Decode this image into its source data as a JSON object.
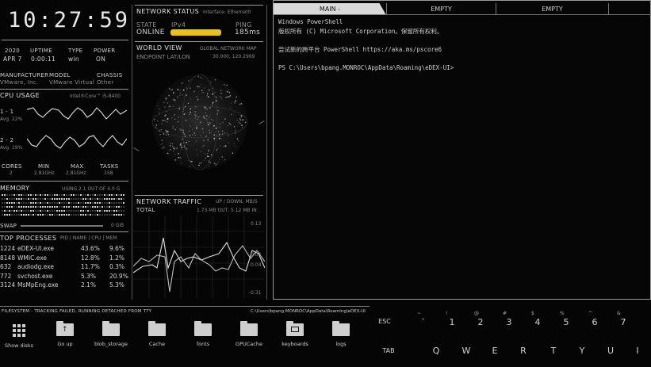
{
  "clock": {
    "time": "10:27:59"
  },
  "sysinfo": {
    "headers": [
      "2020",
      "UPTIME",
      "TYPE",
      "POWER"
    ],
    "values": [
      "APR 7",
      "0:00:11",
      "win",
      "ON"
    ],
    "hw_headers": [
      "MANUFACTURER",
      "MODEL",
      "CHASSIS"
    ],
    "hw_values": [
      "VMware, Inc.",
      "VMware Virtual",
      "Other"
    ]
  },
  "cpu": {
    "title": "CPU USAGE",
    "model": "Intel®Core™ i5-8400",
    "core1_label": "1 - 1",
    "core1_avg": "Avg. 22%",
    "core2_label": "2 - 2",
    "core2_avg": "Avg. 19%",
    "stat_headers": [
      "CORES",
      "MIN",
      "MAX",
      "TASKS"
    ],
    "stat_values": [
      "2",
      "2.81GHz",
      "2.81GHz",
      "158"
    ]
  },
  "memory": {
    "title": "MEMORY",
    "usage": "USING 2.1 OUT OF 4.0 G",
    "swap_label": "SWAP",
    "swap_value": "0 GiB"
  },
  "processes": {
    "title": "TOP PROCESSES",
    "header": "PID | NAME | CPU | MEM",
    "rows": [
      {
        "pid": "1224",
        "name": "eDEX-UI.exe",
        "cpu": "43.6%",
        "mem": "9.6%"
      },
      {
        "pid": "8148",
        "name": "WMIC.exe",
        "cpu": "12.8%",
        "mem": "1.2%"
      },
      {
        "pid": "632",
        "name": "audiodg.exe",
        "cpu": "11.7%",
        "mem": "0.3%"
      },
      {
        "pid": "772",
        "name": "svchost.exe",
        "cpu": "5.3%",
        "mem": "20.9%"
      },
      {
        "pid": "3124",
        "name": "MsMpEng.exe",
        "cpu": "2.1%",
        "mem": "5.3%"
      }
    ]
  },
  "network": {
    "title": "NETWORK STATUS",
    "iface": "Interface: Ethernet0",
    "state_label": "STATE",
    "state_value": "ONLINE",
    "ip_label": "IPv4",
    "ping_label": "PING",
    "ping_value": "185ms"
  },
  "worldview": {
    "title": "WORLD VIEW",
    "subtitle": "GLOBAL NETWORK MAP",
    "endpoint_label": "ENDPOINT LAT/LON",
    "endpoint_value": "30.000, 120.2999"
  },
  "traffic": {
    "title": "NETWORK TRAFFIC",
    "subtitle": "UP / DOWN, MB/S",
    "total_label": "TOTAL",
    "total_value": "1.73 MB OUT, 5.12 MB IN",
    "axis_top": "0.13",
    "axis_mid1": "0.04",
    "axis_mid2": "-0.04",
    "axis_bot": "-0.31"
  },
  "terminal": {
    "tabs": [
      "MAIN -",
      "EMPTY",
      "EMPTY"
    ],
    "lines": [
      "Windows PowerShell",
      "版权所有 (C) Microsoft Corporation。保留所有权利。",
      "",
      "尝试新的跨平台 PowerShell https://aka.ms/pscore6",
      "",
      "PS C:\\Users\\bpang.MONROC\\AppData\\Roaming\\eDEX-UI>"
    ]
  },
  "filesystem": {
    "status": "FILESYSTEM - TRACKING FAILED, RUNNING DETACHED FROM TTY",
    "path": "C:\\Users\\bpang.MONROC\\AppData\\Roaming\\eDEX-UI",
    "items": [
      "Show disks",
      "Go up",
      "blob_storage",
      "Cache",
      "fonts",
      "GPUCache",
      "keyboards",
      "logs"
    ]
  },
  "keyboard": {
    "row1": [
      {
        "main": "ESC",
        "sub": ""
      },
      {
        "main": "`",
        "sub": "~"
      },
      {
        "main": "1",
        "sub": "!"
      },
      {
        "main": "2",
        "sub": "@"
      },
      {
        "main": "3",
        "sub": "#"
      },
      {
        "main": "4",
        "sub": "$"
      },
      {
        "main": "5",
        "sub": "%"
      },
      {
        "main": "6",
        "sub": "^"
      },
      {
        "main": "7",
        "sub": "&"
      }
    ],
    "row2": [
      "TAB",
      "Q",
      "W",
      "E",
      "R",
      "T",
      "Y",
      "U",
      "I"
    ]
  }
}
